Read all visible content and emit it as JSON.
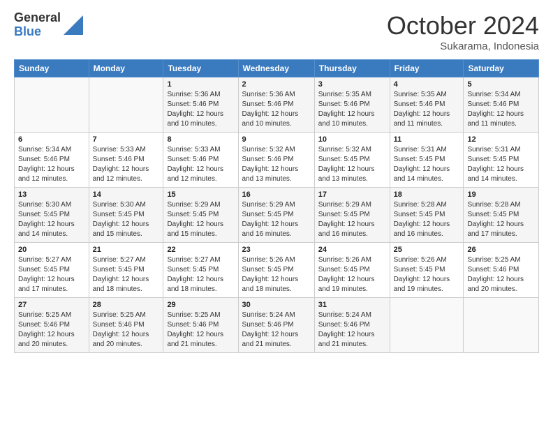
{
  "logo": {
    "general": "General",
    "blue": "Blue"
  },
  "header": {
    "month": "October 2024",
    "location": "Sukarama, Indonesia"
  },
  "days_of_week": [
    "Sunday",
    "Monday",
    "Tuesday",
    "Wednesday",
    "Thursday",
    "Friday",
    "Saturday"
  ],
  "weeks": [
    [
      {
        "day": "",
        "sunrise": "",
        "sunset": "",
        "daylight": ""
      },
      {
        "day": "",
        "sunrise": "",
        "sunset": "",
        "daylight": ""
      },
      {
        "day": "1",
        "sunrise": "Sunrise: 5:36 AM",
        "sunset": "Sunset: 5:46 PM",
        "daylight": "Daylight: 12 hours and 10 minutes."
      },
      {
        "day": "2",
        "sunrise": "Sunrise: 5:36 AM",
        "sunset": "Sunset: 5:46 PM",
        "daylight": "Daylight: 12 hours and 10 minutes."
      },
      {
        "day": "3",
        "sunrise": "Sunrise: 5:35 AM",
        "sunset": "Sunset: 5:46 PM",
        "daylight": "Daylight: 12 hours and 10 minutes."
      },
      {
        "day": "4",
        "sunrise": "Sunrise: 5:35 AM",
        "sunset": "Sunset: 5:46 PM",
        "daylight": "Daylight: 12 hours and 11 minutes."
      },
      {
        "day": "5",
        "sunrise": "Sunrise: 5:34 AM",
        "sunset": "Sunset: 5:46 PM",
        "daylight": "Daylight: 12 hours and 11 minutes."
      }
    ],
    [
      {
        "day": "6",
        "sunrise": "Sunrise: 5:34 AM",
        "sunset": "Sunset: 5:46 PM",
        "daylight": "Daylight: 12 hours and 12 minutes."
      },
      {
        "day": "7",
        "sunrise": "Sunrise: 5:33 AM",
        "sunset": "Sunset: 5:46 PM",
        "daylight": "Daylight: 12 hours and 12 minutes."
      },
      {
        "day": "8",
        "sunrise": "Sunrise: 5:33 AM",
        "sunset": "Sunset: 5:46 PM",
        "daylight": "Daylight: 12 hours and 12 minutes."
      },
      {
        "day": "9",
        "sunrise": "Sunrise: 5:32 AM",
        "sunset": "Sunset: 5:46 PM",
        "daylight": "Daylight: 12 hours and 13 minutes."
      },
      {
        "day": "10",
        "sunrise": "Sunrise: 5:32 AM",
        "sunset": "Sunset: 5:45 PM",
        "daylight": "Daylight: 12 hours and 13 minutes."
      },
      {
        "day": "11",
        "sunrise": "Sunrise: 5:31 AM",
        "sunset": "Sunset: 5:45 PM",
        "daylight": "Daylight: 12 hours and 14 minutes."
      },
      {
        "day": "12",
        "sunrise": "Sunrise: 5:31 AM",
        "sunset": "Sunset: 5:45 PM",
        "daylight": "Daylight: 12 hours and 14 minutes."
      }
    ],
    [
      {
        "day": "13",
        "sunrise": "Sunrise: 5:30 AM",
        "sunset": "Sunset: 5:45 PM",
        "daylight": "Daylight: 12 hours and 14 minutes."
      },
      {
        "day": "14",
        "sunrise": "Sunrise: 5:30 AM",
        "sunset": "Sunset: 5:45 PM",
        "daylight": "Daylight: 12 hours and 15 minutes."
      },
      {
        "day": "15",
        "sunrise": "Sunrise: 5:29 AM",
        "sunset": "Sunset: 5:45 PM",
        "daylight": "Daylight: 12 hours and 15 minutes."
      },
      {
        "day": "16",
        "sunrise": "Sunrise: 5:29 AM",
        "sunset": "Sunset: 5:45 PM",
        "daylight": "Daylight: 12 hours and 16 minutes."
      },
      {
        "day": "17",
        "sunrise": "Sunrise: 5:29 AM",
        "sunset": "Sunset: 5:45 PM",
        "daylight": "Daylight: 12 hours and 16 minutes."
      },
      {
        "day": "18",
        "sunrise": "Sunrise: 5:28 AM",
        "sunset": "Sunset: 5:45 PM",
        "daylight": "Daylight: 12 hours and 16 minutes."
      },
      {
        "day": "19",
        "sunrise": "Sunrise: 5:28 AM",
        "sunset": "Sunset: 5:45 PM",
        "daylight": "Daylight: 12 hours and 17 minutes."
      }
    ],
    [
      {
        "day": "20",
        "sunrise": "Sunrise: 5:27 AM",
        "sunset": "Sunset: 5:45 PM",
        "daylight": "Daylight: 12 hours and 17 minutes."
      },
      {
        "day": "21",
        "sunrise": "Sunrise: 5:27 AM",
        "sunset": "Sunset: 5:45 PM",
        "daylight": "Daylight: 12 hours and 18 minutes."
      },
      {
        "day": "22",
        "sunrise": "Sunrise: 5:27 AM",
        "sunset": "Sunset: 5:45 PM",
        "daylight": "Daylight: 12 hours and 18 minutes."
      },
      {
        "day": "23",
        "sunrise": "Sunrise: 5:26 AM",
        "sunset": "Sunset: 5:45 PM",
        "daylight": "Daylight: 12 hours and 18 minutes."
      },
      {
        "day": "24",
        "sunrise": "Sunrise: 5:26 AM",
        "sunset": "Sunset: 5:45 PM",
        "daylight": "Daylight: 12 hours and 19 minutes."
      },
      {
        "day": "25",
        "sunrise": "Sunrise: 5:26 AM",
        "sunset": "Sunset: 5:45 PM",
        "daylight": "Daylight: 12 hours and 19 minutes."
      },
      {
        "day": "26",
        "sunrise": "Sunrise: 5:25 AM",
        "sunset": "Sunset: 5:46 PM",
        "daylight": "Daylight: 12 hours and 20 minutes."
      }
    ],
    [
      {
        "day": "27",
        "sunrise": "Sunrise: 5:25 AM",
        "sunset": "Sunset: 5:46 PM",
        "daylight": "Daylight: 12 hours and 20 minutes."
      },
      {
        "day": "28",
        "sunrise": "Sunrise: 5:25 AM",
        "sunset": "Sunset: 5:46 PM",
        "daylight": "Daylight: 12 hours and 20 minutes."
      },
      {
        "day": "29",
        "sunrise": "Sunrise: 5:25 AM",
        "sunset": "Sunset: 5:46 PM",
        "daylight": "Daylight: 12 hours and 21 minutes."
      },
      {
        "day": "30",
        "sunrise": "Sunrise: 5:24 AM",
        "sunset": "Sunset: 5:46 PM",
        "daylight": "Daylight: 12 hours and 21 minutes."
      },
      {
        "day": "31",
        "sunrise": "Sunrise: 5:24 AM",
        "sunset": "Sunset: 5:46 PM",
        "daylight": "Daylight: 12 hours and 21 minutes."
      },
      {
        "day": "",
        "sunrise": "",
        "sunset": "",
        "daylight": ""
      },
      {
        "day": "",
        "sunrise": "",
        "sunset": "",
        "daylight": ""
      }
    ]
  ]
}
